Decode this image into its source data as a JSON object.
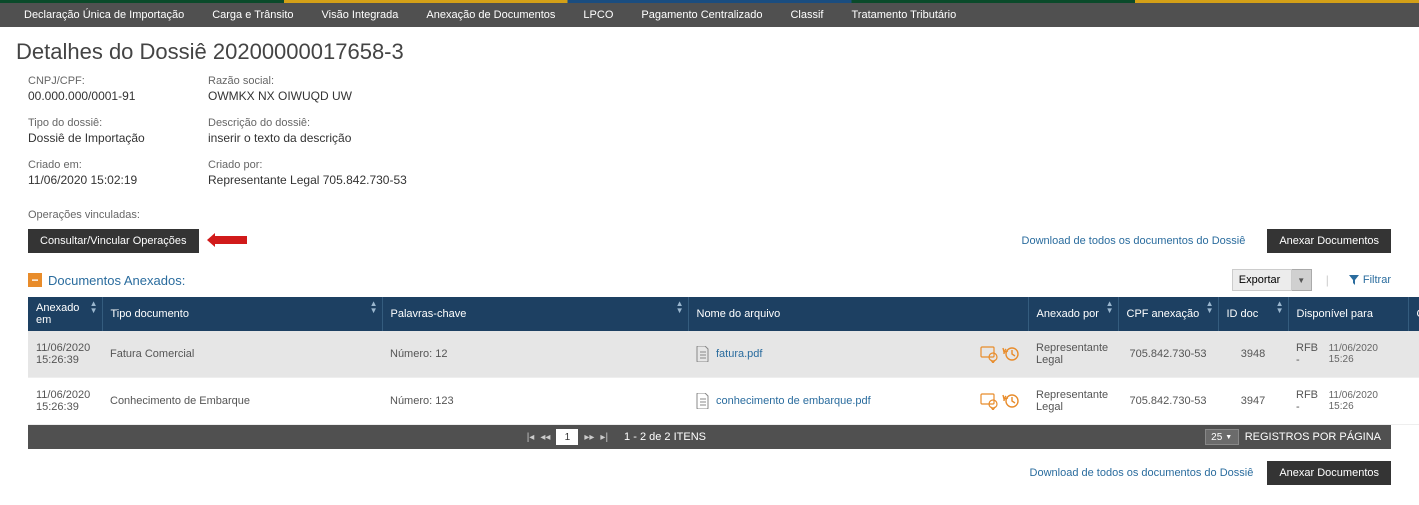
{
  "nav": {
    "items": [
      "Declaração Única de Importação",
      "Carga e Trânsito",
      "Visão Integrada",
      "Anexação de Documentos",
      "LPCO",
      "Pagamento Centralizado",
      "Classif",
      "Tratamento Tributário"
    ]
  },
  "page": {
    "title": "Detalhes do Dossiê 20200000017658-3"
  },
  "details": {
    "cnpj_label": "CNPJ/CPF:",
    "cnpj_value": "00.000.000/0001-91",
    "razao_label": "Razão social:",
    "razao_value": "OWMKX NX OIWUQD UW",
    "tipo_label": "Tipo do dossiê:",
    "tipo_value": "Dossiê de Importação",
    "descricao_label": "Descrição do dossiê:",
    "descricao_value": "inserir o texto da descrição",
    "criado_em_label": "Criado em:",
    "criado_em_value": "11/06/2020 15:02:19",
    "criado_por_label": "Criado por:",
    "criado_por_value": "Representante Legal 705.842.730-53",
    "operacoes_label": "Operações vinculadas:"
  },
  "actions": {
    "consultar": "Consultar/Vincular Operações",
    "download_all": "Download de todos os documentos do Dossiê",
    "anexar": "Anexar Documentos"
  },
  "section": {
    "title": "Documentos Anexados:",
    "export_label": "Exportar",
    "filter_label": "Filtrar"
  },
  "table": {
    "headers": {
      "anexado_em": "Anexado em",
      "tipo": "Tipo documento",
      "palavras": "Palavras-chave",
      "arquivo": "Nome do arquivo",
      "anexado_por": "Anexado por",
      "cpf": "CPF anexação",
      "id": "ID doc",
      "disponivel": "Disponível para",
      "orgao": "Órgão"
    },
    "rows": [
      {
        "anexado_em": "11/06/2020 15:26:39",
        "tipo": "Fatura Comercial",
        "palavras": "Número: 12",
        "arquivo": "fatura.pdf",
        "anexado_por": "Representante Legal",
        "cpf": "705.842.730-53",
        "id": "3948",
        "disp_org": "RFB -",
        "disp_date": "11/06/2020 15:26"
      },
      {
        "anexado_em": "11/06/2020 15:26:39",
        "tipo": "Conhecimento de Embarque",
        "palavras": "Número: 123",
        "arquivo": "conhecimento de embarque.pdf",
        "anexado_por": "Representante Legal",
        "cpf": "705.842.730-53",
        "id": "3947",
        "disp_org": "RFB -",
        "disp_date": "11/06/2020 15:26"
      }
    ]
  },
  "footer": {
    "page": "1",
    "range": "1 - 2 de 2 ITENS",
    "per_page": "25",
    "per_page_label": "REGISTROS POR PÁGINA"
  }
}
